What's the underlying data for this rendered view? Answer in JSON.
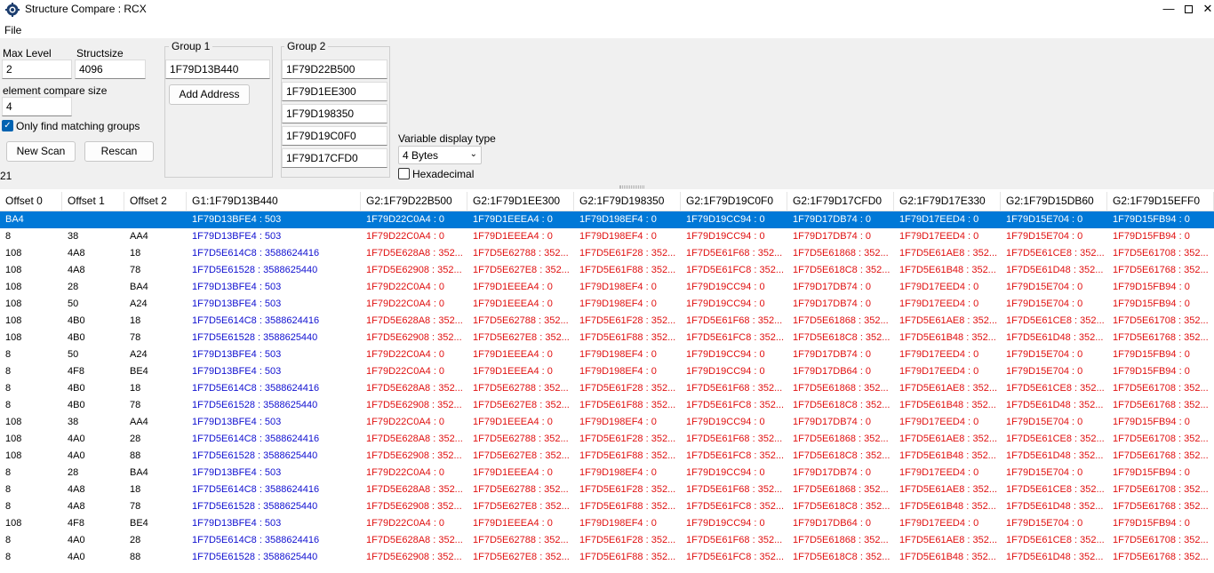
{
  "window": {
    "title": "Structure Compare : RCX",
    "minimize_glyph": "—",
    "close_glyph": "✕"
  },
  "menu": {
    "file": "File"
  },
  "settings": {
    "max_level_label": "Max Level",
    "max_level_value": "2",
    "structsize_label": "Structsize",
    "structsize_value": "4096",
    "element_compare_size_label": "element compare size",
    "element_compare_size_value": "4",
    "only_matching_label": "Only find matching groups",
    "only_matching_checked": true,
    "new_scan_label": "New Scan",
    "rescan_label": "Rescan",
    "result_count": "21"
  },
  "group1": {
    "title": "Group 1",
    "addresses": [
      "1F79D13B440"
    ],
    "add_address_label": "Add Address"
  },
  "group2": {
    "title": "Group 2",
    "addresses": [
      "1F79D22B500",
      "1F79D1EE300",
      "1F79D198350",
      "1F79D19C0F0",
      "1F79D17CFD0"
    ]
  },
  "display": {
    "variable_display_type_label": "Variable display type",
    "variable_display_type_value": "4 Bytes",
    "hexadecimal_label": "Hexadecimal",
    "hexadecimal_checked": false
  },
  "colors": {
    "selection": "#0078d7",
    "group1_text": "#1010d0",
    "group2_text": "#e01010"
  },
  "table": {
    "columns": [
      "Offset 0",
      "Offset 1",
      "Offset 2",
      "G1:1F79D13B440",
      "G2:1F79D22B500",
      "G2:1F79D1EE300",
      "G2:1F79D198350",
      "G2:1F79D19C0F0",
      "G2:1F79D17CFD0",
      "G2:1F79D17E330",
      "G2:1F79D15DB60",
      "G2:1F79D15EFF0"
    ],
    "selected_row": 0,
    "rows": [
      [
        "BA4",
        "",
        "",
        "1F79D13BFE4 : 503",
        "1F79D22C0A4 : 0",
        "1F79D1EEEA4 : 0",
        "1F79D198EF4 : 0",
        "1F79D19CC94 : 0",
        "1F79D17DB74 : 0",
        "1F79D17EED4 : 0",
        "1F79D15E704 : 0",
        "1F79D15FB94 : 0"
      ],
      [
        "8",
        "38",
        "AA4",
        "1F79D13BFE4 : 503",
        "1F79D22C0A4 : 0",
        "1F79D1EEEA4 : 0",
        "1F79D198EF4 : 0",
        "1F79D19CC94 : 0",
        "1F79D17DB74 : 0",
        "1F79D17EED4 : 0",
        "1F79D15E704 : 0",
        "1F79D15FB94 : 0"
      ],
      [
        "108",
        "4A8",
        "18",
        "1F7D5E614C8 : 3588624416",
        "1F7D5E628A8 : 352...",
        "1F7D5E62788 : 352...",
        "1F7D5E61F28 : 352...",
        "1F7D5E61F68 : 352...",
        "1F7D5E61868 : 352...",
        "1F7D5E61AE8 : 352...",
        "1F7D5E61CE8 : 352...",
        "1F7D5E61708 : 352..."
      ],
      [
        "108",
        "4A8",
        "78",
        "1F7D5E61528 : 3588625440",
        "1F7D5E62908 : 352...",
        "1F7D5E627E8 : 352...",
        "1F7D5E61F88 : 352...",
        "1F7D5E61FC8 : 352...",
        "1F7D5E618C8 : 352...",
        "1F7D5E61B48 : 352...",
        "1F7D5E61D48 : 352...",
        "1F7D5E61768 : 352..."
      ],
      [
        "108",
        "28",
        "BA4",
        "1F79D13BFE4 : 503",
        "1F79D22C0A4 : 0",
        "1F79D1EEEA4 : 0",
        "1F79D198EF4 : 0",
        "1F79D19CC94 : 0",
        "1F79D17DB74 : 0",
        "1F79D17EED4 : 0",
        "1F79D15E704 : 0",
        "1F79D15FB94 : 0"
      ],
      [
        "108",
        "50",
        "A24",
        "1F79D13BFE4 : 503",
        "1F79D22C0A4 : 0",
        "1F79D1EEEA4 : 0",
        "1F79D198EF4 : 0",
        "1F79D19CC94 : 0",
        "1F79D17DB74 : 0",
        "1F79D17EED4 : 0",
        "1F79D15E704 : 0",
        "1F79D15FB94 : 0"
      ],
      [
        "108",
        "4B0",
        "18",
        "1F7D5E614C8 : 3588624416",
        "1F7D5E628A8 : 352...",
        "1F7D5E62788 : 352...",
        "1F7D5E61F28 : 352...",
        "1F7D5E61F68 : 352...",
        "1F7D5E61868 : 352...",
        "1F7D5E61AE8 : 352...",
        "1F7D5E61CE8 : 352...",
        "1F7D5E61708 : 352..."
      ],
      [
        "108",
        "4B0",
        "78",
        "1F7D5E61528 : 3588625440",
        "1F7D5E62908 : 352...",
        "1F7D5E627E8 : 352...",
        "1F7D5E61F88 : 352...",
        "1F7D5E61FC8 : 352...",
        "1F7D5E618C8 : 352...",
        "1F7D5E61B48 : 352...",
        "1F7D5E61D48 : 352...",
        "1F7D5E61768 : 352..."
      ],
      [
        "8",
        "50",
        "A24",
        "1F79D13BFE4 : 503",
        "1F79D22C0A4 : 0",
        "1F79D1EEEA4 : 0",
        "1F79D198EF4 : 0",
        "1F79D19CC94 : 0",
        "1F79D17DB74 : 0",
        "1F79D17EED4 : 0",
        "1F79D15E704 : 0",
        "1F79D15FB94 : 0"
      ],
      [
        "8",
        "4F8",
        "BE4",
        "1F79D13BFE4 : 503",
        "1F79D22C0A4 : 0",
        "1F79D1EEEA4 : 0",
        "1F79D198EF4 : 0",
        "1F79D19CC94 : 0",
        "1F79D17DB64 : 0",
        "1F79D17EED4 : 0",
        "1F79D15E704 : 0",
        "1F79D15FB94 : 0"
      ],
      [
        "8",
        "4B0",
        "18",
        "1F7D5E614C8 : 3588624416",
        "1F7D5E628A8 : 352...",
        "1F7D5E62788 : 352...",
        "1F7D5E61F28 : 352...",
        "1F7D5E61F68 : 352...",
        "1F7D5E61868 : 352...",
        "1F7D5E61AE8 : 352...",
        "1F7D5E61CE8 : 352...",
        "1F7D5E61708 : 352..."
      ],
      [
        "8",
        "4B0",
        "78",
        "1F7D5E61528 : 3588625440",
        "1F7D5E62908 : 352...",
        "1F7D5E627E8 : 352...",
        "1F7D5E61F88 : 352...",
        "1F7D5E61FC8 : 352...",
        "1F7D5E618C8 : 352...",
        "1F7D5E61B48 : 352...",
        "1F7D5E61D48 : 352...",
        "1F7D5E61768 : 352..."
      ],
      [
        "108",
        "38",
        "AA4",
        "1F79D13BFE4 : 503",
        "1F79D22C0A4 : 0",
        "1F79D1EEEA4 : 0",
        "1F79D198EF4 : 0",
        "1F79D19CC94 : 0",
        "1F79D17DB74 : 0",
        "1F79D17EED4 : 0",
        "1F79D15E704 : 0",
        "1F79D15FB94 : 0"
      ],
      [
        "108",
        "4A0",
        "28",
        "1F7D5E614C8 : 3588624416",
        "1F7D5E628A8 : 352...",
        "1F7D5E62788 : 352...",
        "1F7D5E61F28 : 352...",
        "1F7D5E61F68 : 352...",
        "1F7D5E61868 : 352...",
        "1F7D5E61AE8 : 352...",
        "1F7D5E61CE8 : 352...",
        "1F7D5E61708 : 352..."
      ],
      [
        "108",
        "4A0",
        "88",
        "1F7D5E61528 : 3588625440",
        "1F7D5E62908 : 352...",
        "1F7D5E627E8 : 352...",
        "1F7D5E61F88 : 352...",
        "1F7D5E61FC8 : 352...",
        "1F7D5E618C8 : 352...",
        "1F7D5E61B48 : 352...",
        "1F7D5E61D48 : 352...",
        "1F7D5E61768 : 352..."
      ],
      [
        "8",
        "28",
        "BA4",
        "1F79D13BFE4 : 503",
        "1F79D22C0A4 : 0",
        "1F79D1EEEA4 : 0",
        "1F79D198EF4 : 0",
        "1F79D19CC94 : 0",
        "1F79D17DB74 : 0",
        "1F79D17EED4 : 0",
        "1F79D15E704 : 0",
        "1F79D15FB94 : 0"
      ],
      [
        "8",
        "4A8",
        "18",
        "1F7D5E614C8 : 3588624416",
        "1F7D5E628A8 : 352...",
        "1F7D5E62788 : 352...",
        "1F7D5E61F28 : 352...",
        "1F7D5E61F68 : 352...",
        "1F7D5E61868 : 352...",
        "1F7D5E61AE8 : 352...",
        "1F7D5E61CE8 : 352...",
        "1F7D5E61708 : 352..."
      ],
      [
        "8",
        "4A8",
        "78",
        "1F7D5E61528 : 3588625440",
        "1F7D5E62908 : 352...",
        "1F7D5E627E8 : 352...",
        "1F7D5E61F88 : 352...",
        "1F7D5E61FC8 : 352...",
        "1F7D5E618C8 : 352...",
        "1F7D5E61B48 : 352...",
        "1F7D5E61D48 : 352...",
        "1F7D5E61768 : 352..."
      ],
      [
        "108",
        "4F8",
        "BE4",
        "1F79D13BFE4 : 503",
        "1F79D22C0A4 : 0",
        "1F79D1EEEA4 : 0",
        "1F79D198EF4 : 0",
        "1F79D19CC94 : 0",
        "1F79D17DB64 : 0",
        "1F79D17EED4 : 0",
        "1F79D15E704 : 0",
        "1F79D15FB94 : 0"
      ],
      [
        "8",
        "4A0",
        "28",
        "1F7D5E614C8 : 3588624416",
        "1F7D5E628A8 : 352...",
        "1F7D5E62788 : 352...",
        "1F7D5E61F28 : 352...",
        "1F7D5E61F68 : 352...",
        "1F7D5E61868 : 352...",
        "1F7D5E61AE8 : 352...",
        "1F7D5E61CE8 : 352...",
        "1F7D5E61708 : 352..."
      ],
      [
        "8",
        "4A0",
        "88",
        "1F7D5E61528 : 3588625440",
        "1F7D5E62908 : 352...",
        "1F7D5E627E8 : 352...",
        "1F7D5E61F88 : 352...",
        "1F7D5E61FC8 : 352...",
        "1F7D5E618C8 : 352...",
        "1F7D5E61B48 : 352...",
        "1F7D5E61D48 : 352...",
        "1F7D5E61768 : 352..."
      ]
    ]
  }
}
